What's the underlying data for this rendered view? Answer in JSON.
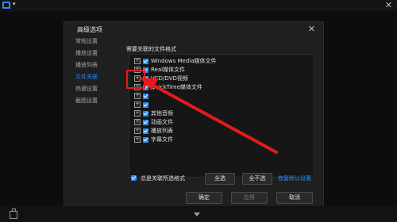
{
  "colors": {
    "accent": "#2d8cf0",
    "annotation": "#e31b1b"
  },
  "topbar": {
    "app_icon": "player-logo-icon",
    "menu_caret": "▾",
    "close_glyph": "✕"
  },
  "dialog": {
    "title": "高级选项",
    "close_glyph": "✕",
    "sidebar": [
      {
        "label": "常规设置",
        "active": false
      },
      {
        "label": "播放设置",
        "active": false
      },
      {
        "label": "播放列表",
        "active": false
      },
      {
        "label": "文件关联",
        "active": true
      },
      {
        "label": "热键设置",
        "active": false
      },
      {
        "label": "截图设置",
        "active": false
      }
    ],
    "section_title": "需要关联的文件格式",
    "file_types": [
      {
        "expander": "+",
        "label": "Windows Media媒体文件",
        "checked": true
      },
      {
        "expander": "+",
        "label": "Real媒体文件",
        "checked": true
      },
      {
        "expander": "+",
        "label": "VCD/DVD视频",
        "checked": true
      },
      {
        "expander": "+",
        "label": "QuickTime媒体文件",
        "checked": true
      },
      {
        "expander": "+",
        "label": "",
        "checked": true
      },
      {
        "expander": "+",
        "label": "",
        "checked": true
      },
      {
        "expander": "+",
        "label": "其他音频",
        "checked": true
      },
      {
        "expander": "+",
        "label": "动画文件",
        "checked": true
      },
      {
        "expander": "+",
        "label": "播放列表",
        "checked": true
      },
      {
        "expander": "+",
        "label": "字幕文件",
        "checked": true
      }
    ],
    "always_associate": {
      "label": "总是关联所选格式",
      "checked": true
    },
    "select_all": "全选",
    "select_none": "全不选",
    "restore_default": "恢复默认设置",
    "footer": {
      "ok": "确定",
      "apply": "应用",
      "cancel": "取消"
    }
  },
  "statusbar": {
    "left_icon": "library-icon",
    "center_icon": "collapse-arrow-icon"
  }
}
